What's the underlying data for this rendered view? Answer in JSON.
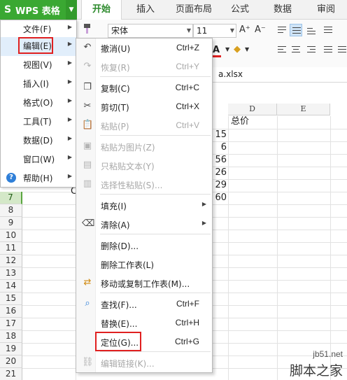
{
  "app": {
    "logo": "S",
    "title": "WPS 表格",
    "menu_arrow": "▼"
  },
  "tabs": [
    "开始",
    "插入",
    "页面布局",
    "公式",
    "数据",
    "审阅"
  ],
  "ribbon": {
    "font_name": "宋体",
    "font_size": "11",
    "grow_font": "A⁺",
    "shrink_font": "A⁻",
    "font_color": "A"
  },
  "file_tab": {
    "name": "a.xlsx"
  },
  "grid": {
    "columns": [
      "D",
      "E"
    ],
    "rows": [
      "7",
      "8",
      "9",
      "10",
      "11",
      "12",
      "13",
      "14",
      "15",
      "16",
      "17",
      "18",
      "19",
      "20",
      "21"
    ],
    "header_text": "总价",
    "values": [
      "15",
      "6",
      "56",
      "26",
      "29",
      "60"
    ],
    "partial_cell": "C"
  },
  "main_menu": {
    "items": [
      {
        "label": "文件(F)",
        "arrow": "▶"
      },
      {
        "label": "编辑(E)",
        "arrow": "▶"
      },
      {
        "label": "视图(V)",
        "arrow": "▶"
      },
      {
        "label": "插入(I)",
        "arrow": "▶"
      },
      {
        "label": "格式(O)",
        "arrow": "▶"
      },
      {
        "label": "工具(T)",
        "arrow": "▶"
      },
      {
        "label": "数据(D)",
        "arrow": "▶"
      },
      {
        "label": "窗口(W)",
        "arrow": "▶"
      },
      {
        "label": "帮助(H)",
        "arrow": "▶"
      }
    ],
    "help_icon": "?"
  },
  "edit_menu": {
    "items": [
      {
        "label": "撤消(U)",
        "shortcut": "Ctrl+Z",
        "icon": "undo-icon"
      },
      {
        "label": "恢复(R)",
        "shortcut": "Ctrl+Y",
        "icon": "redo-icon"
      },
      {
        "label": "复制(C)",
        "shortcut": "Ctrl+C",
        "icon": "copy-icon"
      },
      {
        "label": "剪切(T)",
        "shortcut": "Ctrl+X",
        "icon": "cut-icon"
      },
      {
        "label": "粘贴(P)",
        "shortcut": "Ctrl+V",
        "icon": "paste-icon"
      },
      {
        "label": "粘贴为图片(Z)",
        "shortcut": "",
        "icon": "paste-image-icon"
      },
      {
        "label": "只粘贴文本(Y)",
        "shortcut": "",
        "icon": "paste-text-icon"
      },
      {
        "label": "选择性粘贴(S)...",
        "shortcut": "",
        "icon": "paste-special-icon"
      },
      {
        "label": "填充(I)",
        "shortcut": "",
        "arrow": "▶"
      },
      {
        "label": "清除(A)",
        "shortcut": "",
        "arrow": "▶",
        "icon": "eraser-icon"
      },
      {
        "label": "删除(D)...",
        "shortcut": ""
      },
      {
        "label": "删除工作表(L)",
        "shortcut": ""
      },
      {
        "label": "移动或复制工作表(M)...",
        "shortcut": "",
        "icon": "move-sheet-icon"
      },
      {
        "label": "查找(F)...",
        "shortcut": "Ctrl+F",
        "icon": "find-icon"
      },
      {
        "label": "替换(E)...",
        "shortcut": "Ctrl+H"
      },
      {
        "label": "定位(G)...",
        "shortcut": "Ctrl+G"
      },
      {
        "label": "编辑链接(K)...",
        "shortcut": "",
        "icon": "link-icon"
      }
    ]
  },
  "watermark": {
    "url": "jb51.net",
    "name": "脚本之家"
  },
  "colors": {
    "wps_green": "#3aa832",
    "highlight_red": "#e02020",
    "selected_row": "#d4e8c8"
  }
}
